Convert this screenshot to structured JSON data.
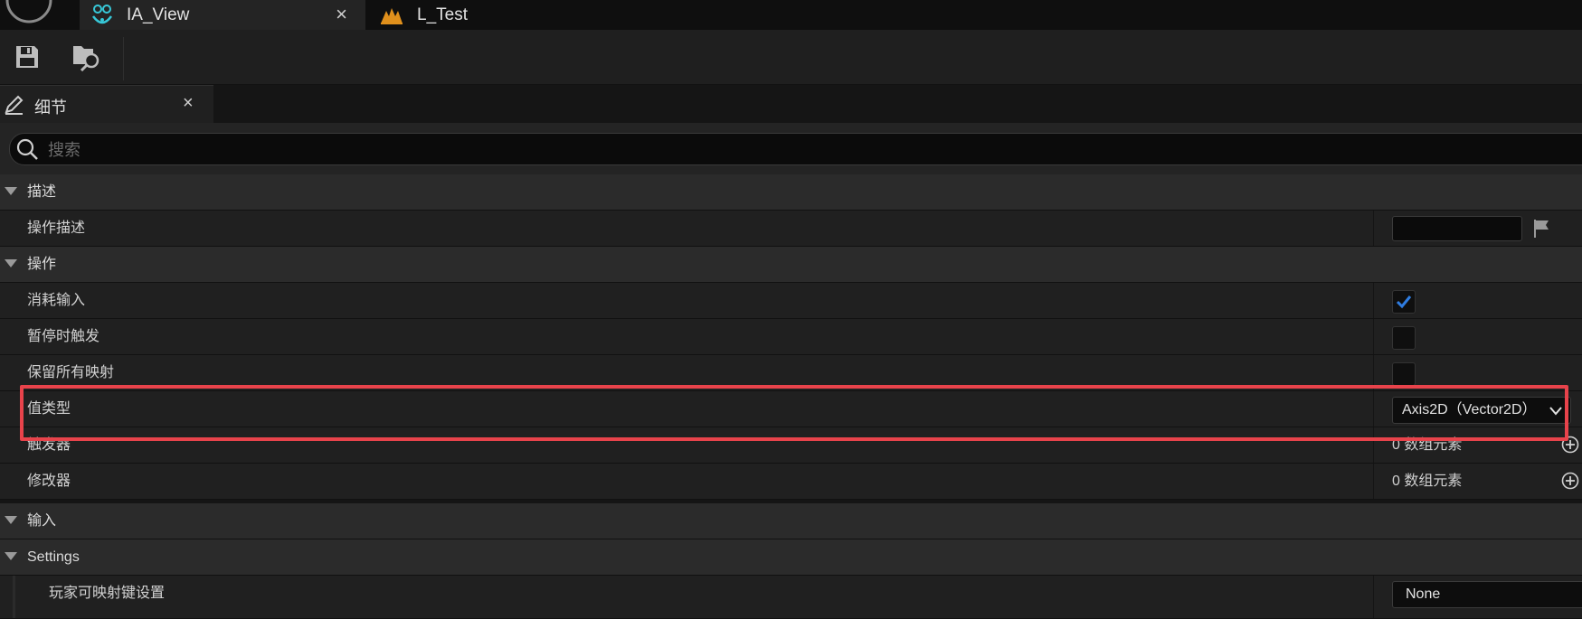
{
  "tabs": [
    {
      "label": "IA_View",
      "icon": "input-action-icon",
      "close": "×",
      "active": true
    },
    {
      "label": "L_Test",
      "icon": "level-icon",
      "active": false
    }
  ],
  "toolbar": {
    "save": {
      "icon": "save-icon"
    },
    "browse": {
      "icon": "browse-asset-icon"
    }
  },
  "details_tab": {
    "label": "细节",
    "icon": "details-pencil-icon",
    "close": "×"
  },
  "search": {
    "placeholder": "搜索",
    "icon": "search-icon"
  },
  "sections": {
    "description": {
      "label": "描述",
      "action_description": {
        "label": "操作描述",
        "value": ""
      }
    },
    "action": {
      "label": "操作",
      "consume_input": {
        "label": "消耗输入",
        "checked": true
      },
      "trigger_when_paused": {
        "label": "暂停时触发",
        "checked": false
      },
      "reserve_all_mappings": {
        "label": "保留所有映射",
        "checked": false
      },
      "value_type": {
        "label": "值类型",
        "value": "Axis2D（Vector2D）"
      },
      "triggers": {
        "label": "触发器",
        "value": "0 数组元素"
      },
      "modifiers": {
        "label": "修改器",
        "value": "0 数组元素"
      }
    },
    "input": {
      "label": "输入"
    },
    "settings": {
      "label": "Settings",
      "player_mappable_key_settings": {
        "label": "玩家可映射键设置",
        "value": "None"
      }
    }
  },
  "colors": {
    "accent_check": "#2f7de1",
    "highlight": "#e8434b",
    "tab_icon_cyan": "#37c8d8",
    "level_icon_orange": "#e0901c"
  }
}
